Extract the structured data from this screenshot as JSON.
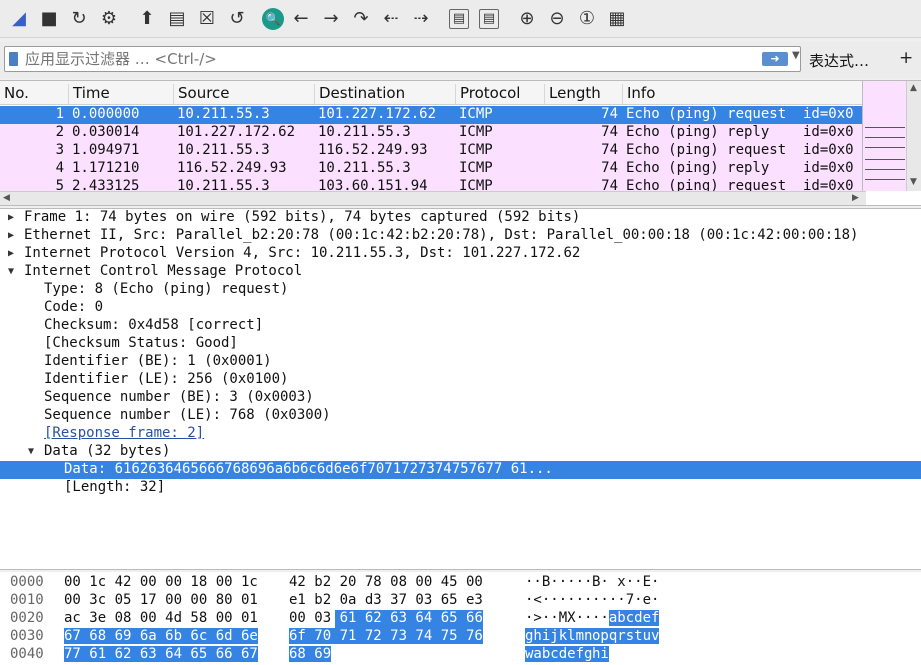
{
  "toolbar": {
    "icons": [
      "shark-fin-start-icon",
      "stop-icon",
      "restart-icon",
      "options-gear-icon",
      "open-file-icon",
      "save-file-icon",
      "close-file-icon",
      "reload-icon",
      "find-icon",
      "go-back-icon",
      "go-forward-icon",
      "go-to-packet-icon",
      "previous-packet-icon",
      "next-packet-icon",
      "first-packet-icon",
      "last-packet-icon",
      "zoom-in-icon",
      "zoom-out-icon",
      "normal-size-icon",
      "resize-columns-icon"
    ],
    "glyphs": [
      "◢",
      "■",
      "↻",
      "⚙",
      "⬆",
      "▤",
      "☒",
      "↺",
      "🔍",
      "←",
      "→",
      "↷",
      "⇠",
      "⇢",
      "▤",
      "▤",
      "⊕",
      "⊖",
      "①",
      "▦"
    ]
  },
  "filter": {
    "placeholder": "应用显示过滤器 … <Ctrl-/>",
    "expression_label": "表达式…",
    "add_label": "+"
  },
  "packet_list": {
    "columns": [
      "No.",
      "Time",
      "Source",
      "Destination",
      "Protocol",
      "Length",
      "Info"
    ],
    "rows": [
      {
        "no": "1",
        "time": "0.000000",
        "source": "10.211.55.3",
        "destination": "101.227.172.62",
        "protocol": "ICMP",
        "length": "74",
        "info": "Echo (ping) request  id=0x0"
      },
      {
        "no": "2",
        "time": "0.030014",
        "source": "101.227.172.62",
        "destination": "10.211.55.3",
        "protocol": "ICMP",
        "length": "74",
        "info": "Echo (ping) reply    id=0x0"
      },
      {
        "no": "3",
        "time": "1.094971",
        "source": "10.211.55.3",
        "destination": "116.52.249.93",
        "protocol": "ICMP",
        "length": "74",
        "info": "Echo (ping) request  id=0x0"
      },
      {
        "no": "4",
        "time": "1.171210",
        "source": "116.52.249.93",
        "destination": "10.211.55.3",
        "protocol": "ICMP",
        "length": "74",
        "info": "Echo (ping) reply    id=0x0"
      },
      {
        "no": "5",
        "time": "2.433125",
        "source": "10.211.55.3",
        "destination": "103.60.151.94",
        "protocol": "ICMP",
        "length": "74",
        "info": "Echo (ping) request  id=0x0"
      }
    ]
  },
  "details": [
    {
      "tw": "▶",
      "indent": 0,
      "text": "Frame 1: 74 bytes on wire (592 bits), 74 bytes captured (592 bits)"
    },
    {
      "tw": "▶",
      "indent": 0,
      "text": "Ethernet II, Src: Parallel_b2:20:78 (00:1c:42:b2:20:78), Dst: Parallel_00:00:18 (00:1c:42:00:00:18)"
    },
    {
      "tw": "▶",
      "indent": 0,
      "text": "Internet Protocol Version 4, Src: 10.211.55.3, Dst: 101.227.172.62"
    },
    {
      "tw": "▼",
      "indent": 0,
      "text": "Internet Control Message Protocol"
    },
    {
      "tw": "",
      "indent": 1,
      "text": "Type: 8 (Echo (ping) request)"
    },
    {
      "tw": "",
      "indent": 1,
      "text": "Code: 0"
    },
    {
      "tw": "",
      "indent": 1,
      "text": "Checksum: 0x4d58 [correct]"
    },
    {
      "tw": "",
      "indent": 1,
      "text": "[Checksum Status: Good]"
    },
    {
      "tw": "",
      "indent": 1,
      "text": "Identifier (BE): 1 (0x0001)"
    },
    {
      "tw": "",
      "indent": 1,
      "text": "Identifier (LE): 256 (0x0100)"
    },
    {
      "tw": "",
      "indent": 1,
      "text": "Sequence number (BE): 3 (0x0003)"
    },
    {
      "tw": "",
      "indent": 1,
      "text": "Sequence number (LE): 768 (0x0300)"
    },
    {
      "tw": "",
      "indent": 1,
      "text": "[Response frame: 2]",
      "link": true
    },
    {
      "tw": "▼",
      "indent": 1,
      "text": "Data (32 bytes)"
    },
    {
      "tw": "",
      "indent": 2,
      "text": "Data: 6162636465666768696a6b6c6d6e6f7071727374757677 61...",
      "selected": true
    },
    {
      "tw": "",
      "indent": 2,
      "text": "[Length: 32]"
    }
  ],
  "hex": [
    {
      "offset": "0000",
      "bytes_a": "00 1c 42 00 00 18 00 1c",
      "bytes_b": "42 b2 20 78 08 00 45 00",
      "ascii_a": "··B·····",
      "ascii_b": "B· x··E·",
      "hl_start": 16
    },
    {
      "offset": "0010",
      "bytes_a": "00 3c 05 17 00 00 80 01",
      "bytes_b": "e1 b2 0a d3 37 03 65 e3",
      "ascii_a": "·<······",
      "ascii_b": "····7·e·",
      "hl_start": 16
    },
    {
      "offset": "0020",
      "bytes_a": "ac 3e 08 00 4d 58 00 01",
      "bytes_b": "00 03 61 62 63 64 65 66",
      "ascii_a": "·>··MX··",
      "ascii_b": "··abcdef",
      "hl_start": 10
    },
    {
      "offset": "0030",
      "bytes_a": "67 68 69 6a 6b 6c 6d 6e",
      "bytes_b": "6f 70 71 72 73 74 75 76",
      "ascii_a": "ghijklmn",
      "ascii_b": "opqrstuv",
      "hl_start": 0
    },
    {
      "offset": "0040",
      "bytes_a": "77 61 62 63 64 65 66 67",
      "bytes_b": "68 69",
      "ascii_a": "wabcdefg",
      "ascii_b": "hi",
      "hl_start": 0
    }
  ],
  "colors": {
    "selection": "#3584e4",
    "icmp_row": "#fce0ff"
  }
}
